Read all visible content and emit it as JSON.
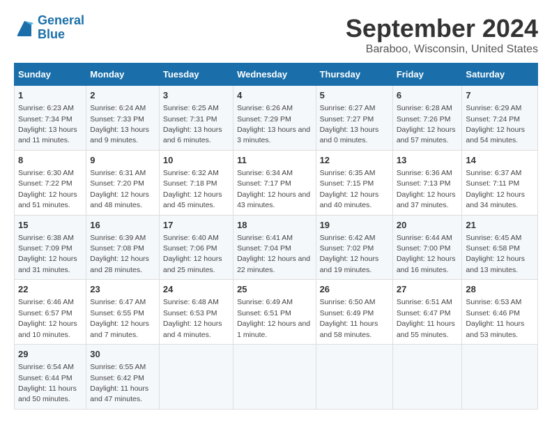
{
  "header": {
    "logo_line1": "General",
    "logo_line2": "Blue",
    "title": "September 2024",
    "subtitle": "Baraboo, Wisconsin, United States"
  },
  "columns": [
    "Sunday",
    "Monday",
    "Tuesday",
    "Wednesday",
    "Thursday",
    "Friday",
    "Saturday"
  ],
  "weeks": [
    [
      {
        "day": "1",
        "sunrise": "6:23 AM",
        "sunset": "7:34 PM",
        "daylight": "13 hours and 11 minutes."
      },
      {
        "day": "2",
        "sunrise": "6:24 AM",
        "sunset": "7:33 PM",
        "daylight": "13 hours and 9 minutes."
      },
      {
        "day": "3",
        "sunrise": "6:25 AM",
        "sunset": "7:31 PM",
        "daylight": "13 hours and 6 minutes."
      },
      {
        "day": "4",
        "sunrise": "6:26 AM",
        "sunset": "7:29 PM",
        "daylight": "13 hours and 3 minutes."
      },
      {
        "day": "5",
        "sunrise": "6:27 AM",
        "sunset": "7:27 PM",
        "daylight": "13 hours and 0 minutes."
      },
      {
        "day": "6",
        "sunrise": "6:28 AM",
        "sunset": "7:26 PM",
        "daylight": "12 hours and 57 minutes."
      },
      {
        "day": "7",
        "sunrise": "6:29 AM",
        "sunset": "7:24 PM",
        "daylight": "12 hours and 54 minutes."
      }
    ],
    [
      {
        "day": "8",
        "sunrise": "6:30 AM",
        "sunset": "7:22 PM",
        "daylight": "12 hours and 51 minutes."
      },
      {
        "day": "9",
        "sunrise": "6:31 AM",
        "sunset": "7:20 PM",
        "daylight": "12 hours and 48 minutes."
      },
      {
        "day": "10",
        "sunrise": "6:32 AM",
        "sunset": "7:18 PM",
        "daylight": "12 hours and 45 minutes."
      },
      {
        "day": "11",
        "sunrise": "6:34 AM",
        "sunset": "7:17 PM",
        "daylight": "12 hours and 43 minutes."
      },
      {
        "day": "12",
        "sunrise": "6:35 AM",
        "sunset": "7:15 PM",
        "daylight": "12 hours and 40 minutes."
      },
      {
        "day": "13",
        "sunrise": "6:36 AM",
        "sunset": "7:13 PM",
        "daylight": "12 hours and 37 minutes."
      },
      {
        "day": "14",
        "sunrise": "6:37 AM",
        "sunset": "7:11 PM",
        "daylight": "12 hours and 34 minutes."
      }
    ],
    [
      {
        "day": "15",
        "sunrise": "6:38 AM",
        "sunset": "7:09 PM",
        "daylight": "12 hours and 31 minutes."
      },
      {
        "day": "16",
        "sunrise": "6:39 AM",
        "sunset": "7:08 PM",
        "daylight": "12 hours and 28 minutes."
      },
      {
        "day": "17",
        "sunrise": "6:40 AM",
        "sunset": "7:06 PM",
        "daylight": "12 hours and 25 minutes."
      },
      {
        "day": "18",
        "sunrise": "6:41 AM",
        "sunset": "7:04 PM",
        "daylight": "12 hours and 22 minutes."
      },
      {
        "day": "19",
        "sunrise": "6:42 AM",
        "sunset": "7:02 PM",
        "daylight": "12 hours and 19 minutes."
      },
      {
        "day": "20",
        "sunrise": "6:44 AM",
        "sunset": "7:00 PM",
        "daylight": "12 hours and 16 minutes."
      },
      {
        "day": "21",
        "sunrise": "6:45 AM",
        "sunset": "6:58 PM",
        "daylight": "12 hours and 13 minutes."
      }
    ],
    [
      {
        "day": "22",
        "sunrise": "6:46 AM",
        "sunset": "6:57 PM",
        "daylight": "12 hours and 10 minutes."
      },
      {
        "day": "23",
        "sunrise": "6:47 AM",
        "sunset": "6:55 PM",
        "daylight": "12 hours and 7 minutes."
      },
      {
        "day": "24",
        "sunrise": "6:48 AM",
        "sunset": "6:53 PM",
        "daylight": "12 hours and 4 minutes."
      },
      {
        "day": "25",
        "sunrise": "6:49 AM",
        "sunset": "6:51 PM",
        "daylight": "12 hours and 1 minute."
      },
      {
        "day": "26",
        "sunrise": "6:50 AM",
        "sunset": "6:49 PM",
        "daylight": "11 hours and 58 minutes."
      },
      {
        "day": "27",
        "sunrise": "6:51 AM",
        "sunset": "6:47 PM",
        "daylight": "11 hours and 55 minutes."
      },
      {
        "day": "28",
        "sunrise": "6:53 AM",
        "sunset": "6:46 PM",
        "daylight": "11 hours and 53 minutes."
      }
    ],
    [
      {
        "day": "29",
        "sunrise": "6:54 AM",
        "sunset": "6:44 PM",
        "daylight": "11 hours and 50 minutes."
      },
      {
        "day": "30",
        "sunrise": "6:55 AM",
        "sunset": "6:42 PM",
        "daylight": "11 hours and 47 minutes."
      },
      null,
      null,
      null,
      null,
      null
    ]
  ]
}
